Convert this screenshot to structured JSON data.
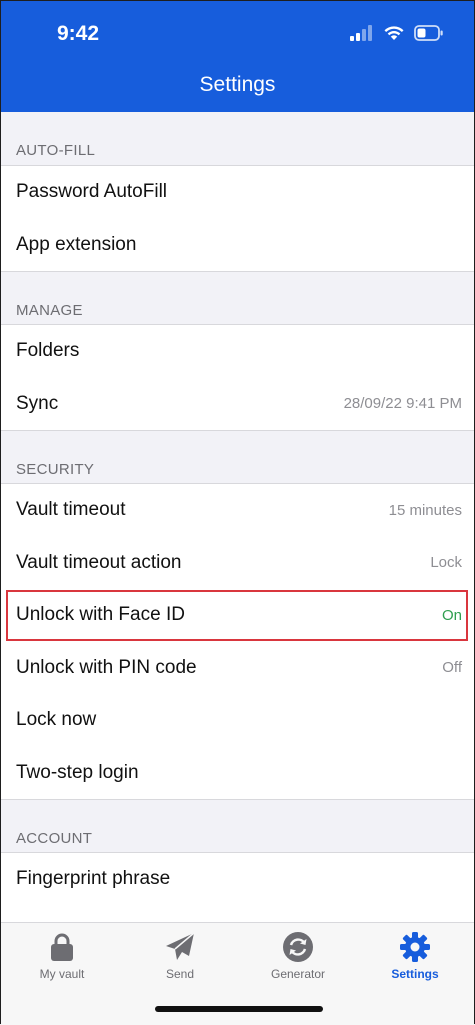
{
  "status_bar": {
    "time": "9:42"
  },
  "nav": {
    "title": "Settings"
  },
  "sections": {
    "autofill": {
      "header": "AUTO-FILL",
      "rows": [
        {
          "label": "Password AutoFill"
        },
        {
          "label": "App extension"
        }
      ]
    },
    "manage": {
      "header": "MANAGE",
      "rows": [
        {
          "label": "Folders"
        },
        {
          "label": "Sync",
          "value": "28/09/22 9:41 PM"
        }
      ]
    },
    "security": {
      "header": "SECURITY",
      "rows": [
        {
          "label": "Vault timeout",
          "value": "15 minutes"
        },
        {
          "label": "Vault timeout action",
          "value": "Lock"
        },
        {
          "label": "Unlock with Face ID",
          "value": "On",
          "highlighted": true
        },
        {
          "label": "Unlock with PIN code",
          "value": "Off"
        },
        {
          "label": "Lock now"
        },
        {
          "label": "Two-step login"
        }
      ]
    },
    "account": {
      "header": "ACCOUNT",
      "rows": [
        {
          "label": "Fingerprint phrase"
        }
      ]
    }
  },
  "tabbar": {
    "items": [
      {
        "label": "My vault",
        "icon": "lock-icon"
      },
      {
        "label": "Send",
        "icon": "paper-plane-icon"
      },
      {
        "label": "Generator",
        "icon": "refresh-icon"
      },
      {
        "label": "Settings",
        "icon": "gear-icon",
        "active": true
      }
    ]
  },
  "colors": {
    "brand": "#175ddc",
    "on_value": "#2f9e4f",
    "highlight_border": "#d9363e",
    "inactive_tab": "#6d6d72"
  }
}
